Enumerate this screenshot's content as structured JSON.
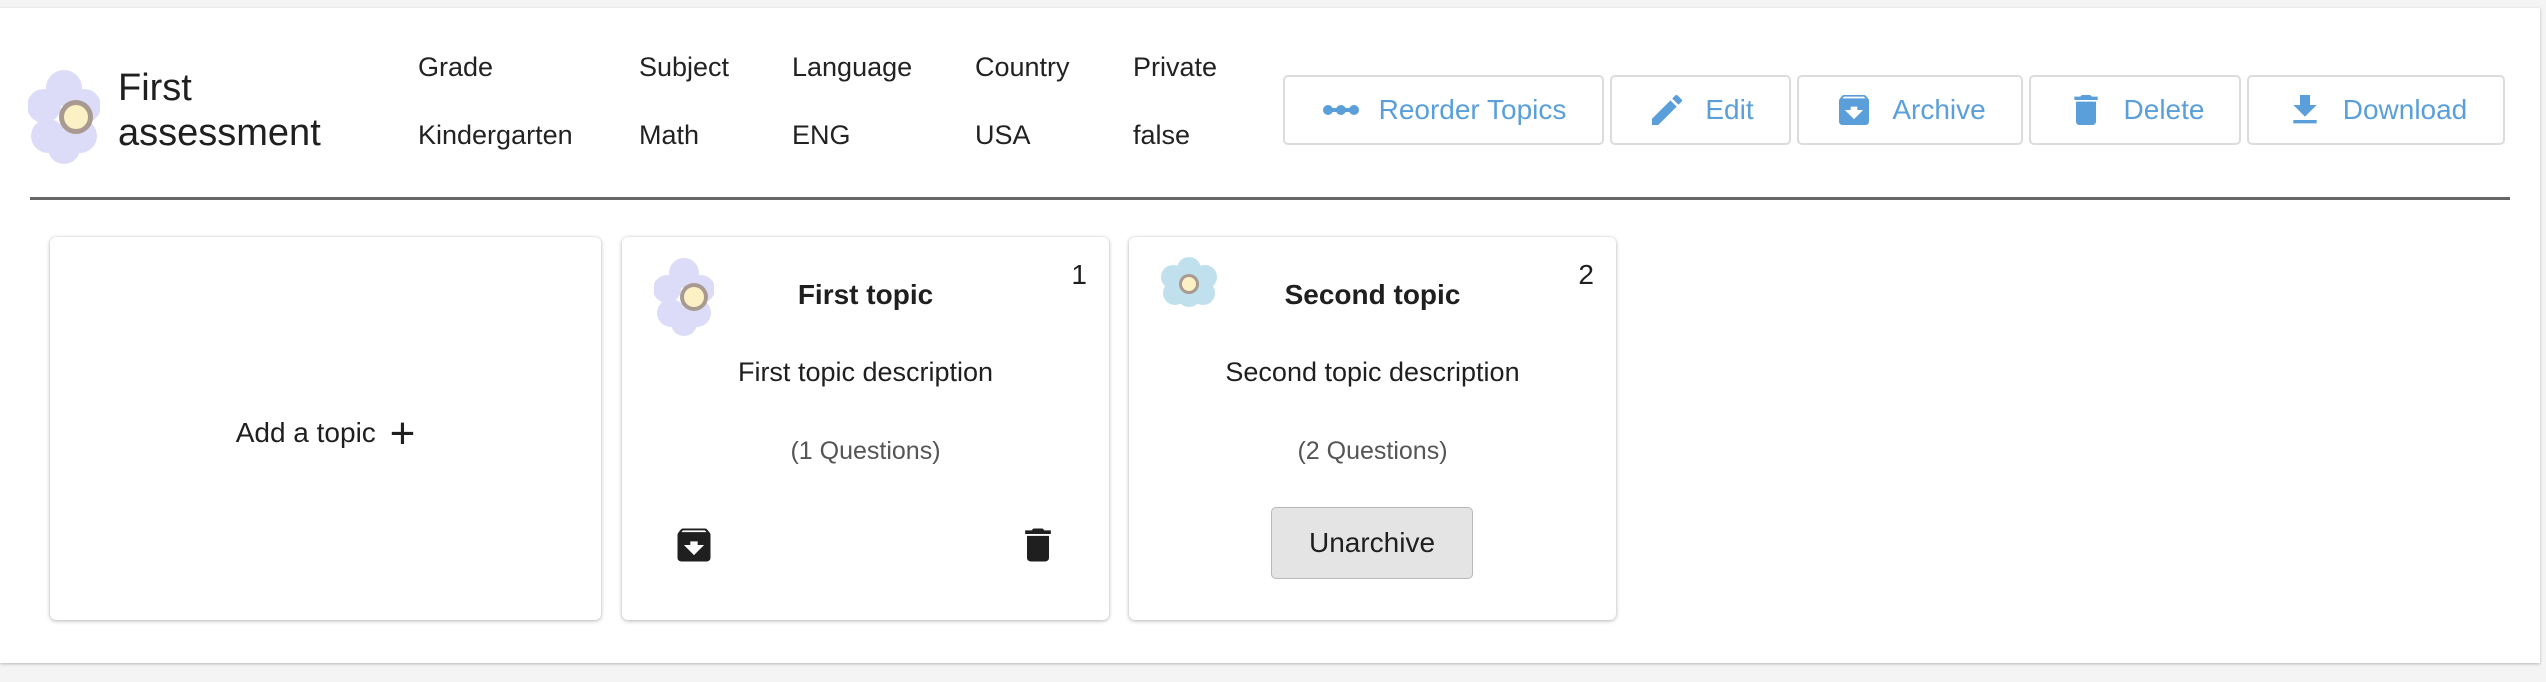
{
  "assessment": {
    "title": "First assessment",
    "meta": [
      {
        "label": "Grade",
        "value": "Kindergarten"
      },
      {
        "label": "Subject",
        "value": "Math"
      },
      {
        "label": "Language",
        "value": "ENG"
      },
      {
        "label": "Country",
        "value": "USA"
      },
      {
        "label": "Private",
        "value": "false"
      }
    ]
  },
  "toolbar": {
    "reorder_label": "Reorder Topics",
    "edit_label": "Edit",
    "archive_label": "Archive",
    "delete_label": "Delete",
    "download_label": "Download"
  },
  "add_topic": {
    "label": "Add a topic",
    "plus": "+"
  },
  "topics": [
    {
      "number": "1",
      "title": "First topic",
      "description": "First topic description",
      "questions": "(1 Questions)",
      "flower_color": "#dcdcf8"
    },
    {
      "number": "2",
      "title": "Second topic",
      "description": "Second topic description",
      "questions": "(2 Questions)",
      "action_label": "Unarchive",
      "flower_color": "#bfe0ec"
    }
  ],
  "colors": {
    "accent": "#5a9fd9",
    "divider": "#666666"
  },
  "icons": [
    "flower-logo-icon",
    "reorder-icon",
    "pencil-icon",
    "archive-icon",
    "trash-icon",
    "download-icon"
  ]
}
